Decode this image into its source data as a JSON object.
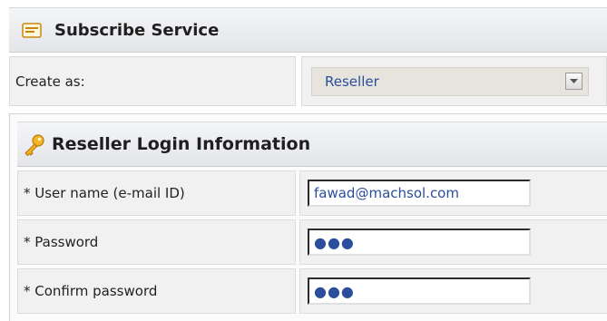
{
  "header": {
    "title": "Subscribe Service",
    "icon": "form-icon"
  },
  "create_as": {
    "label": "Create as:",
    "selected": "Reseller"
  },
  "login_section": {
    "title": "Reseller Login Information",
    "icon": "key-icon",
    "fields": [
      {
        "label": "* User name (e-mail ID)",
        "value": "fawad@machsol.com"
      },
      {
        "label": "* Password",
        "value": "●●●"
      },
      {
        "label": "* Confirm password",
        "value": "●●●"
      }
    ]
  },
  "colors": {
    "accent_text": "#2a4e9c",
    "header_bg": "#e8eaee",
    "key_icon": "#f2a51a"
  }
}
